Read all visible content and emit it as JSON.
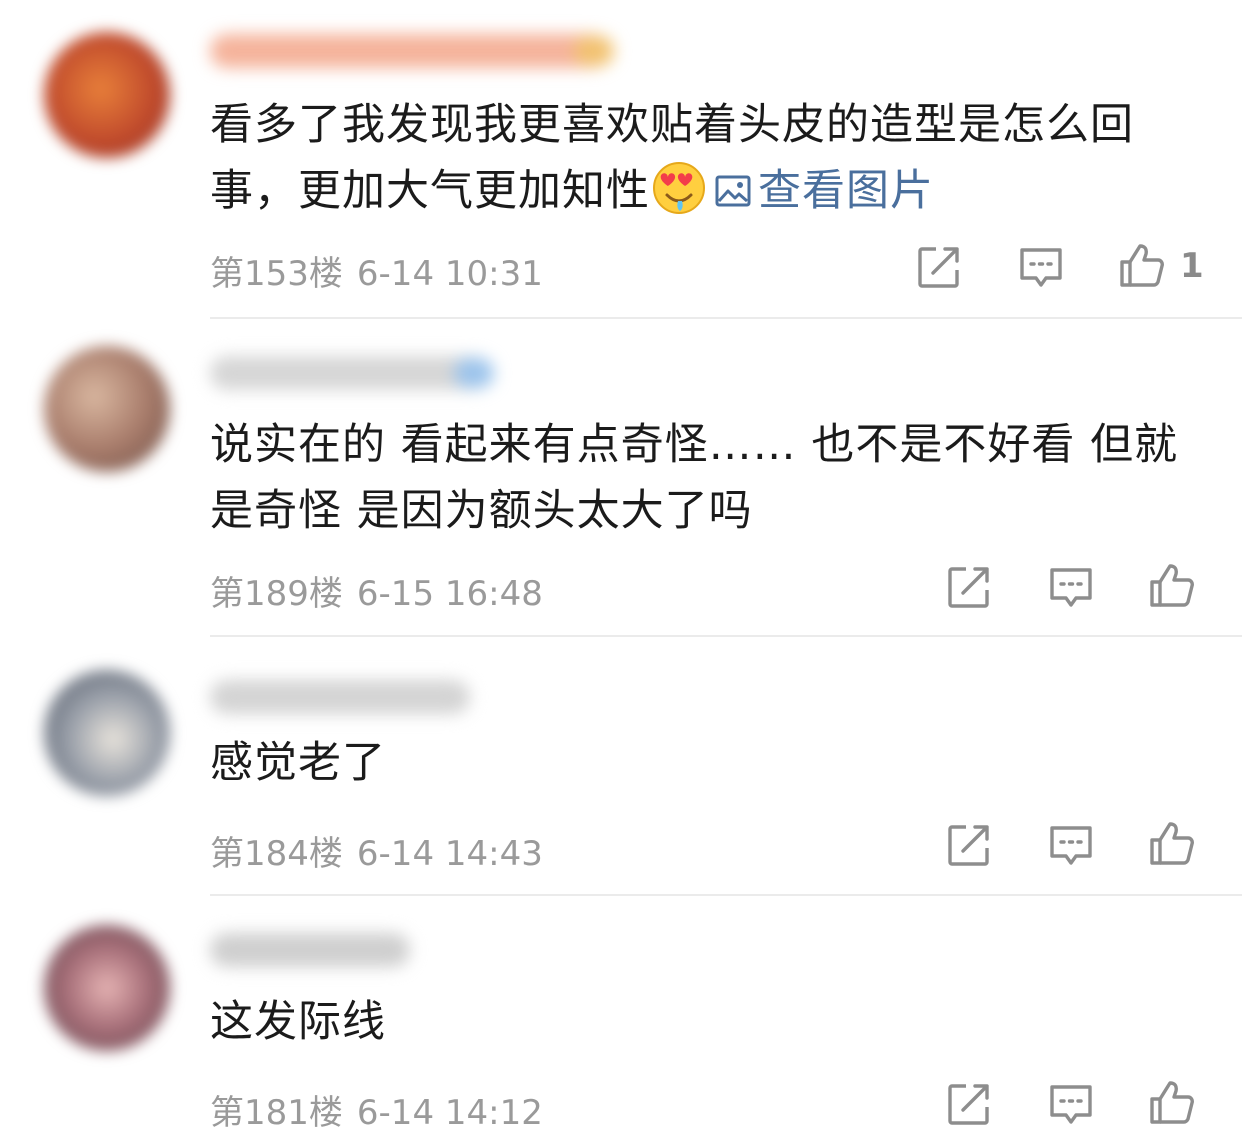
{
  "comments": [
    {
      "text_a": "看多了我发现我更喜欢贴着头皮的造型是怎么回事，更加大气更加知性",
      "emoji": "heart-eyes-emoji",
      "view_pic": "查看图片",
      "floor": "第153楼",
      "time": "6-14 10:31",
      "likes": "1",
      "avatar_color": "#c04a2c",
      "name_color": "#f2a689"
    },
    {
      "text_a": "说实在的 看起来有点奇怪…… 也不是不好看 但就是奇怪 是因为额头太大了吗",
      "floor": "第189楼",
      "time": "6-15 16:48",
      "likes": "",
      "avatar_color": "#a87c6b",
      "name_color": "#c9c9c9"
    },
    {
      "text_a": "感觉老了",
      "floor": "第184楼",
      "time": "6-14 14:43",
      "likes": "",
      "avatar_color": "#7a8290",
      "name_color": "#d0d0d0"
    },
    {
      "text_a": "这发际线",
      "floor": "第181楼",
      "time": "6-14 14:12",
      "likes": "",
      "avatar_color": "#8e5c63",
      "name_color": "#c8c8c8"
    }
  ],
  "icons": {
    "share": "share-icon",
    "reply": "comment-icon",
    "like": "thumbs-up-icon",
    "picture": "picture-icon"
  },
  "colors": {
    "link": "#4a6f9d",
    "meta": "#9a9a9a",
    "divider": "#ebebeb"
  }
}
